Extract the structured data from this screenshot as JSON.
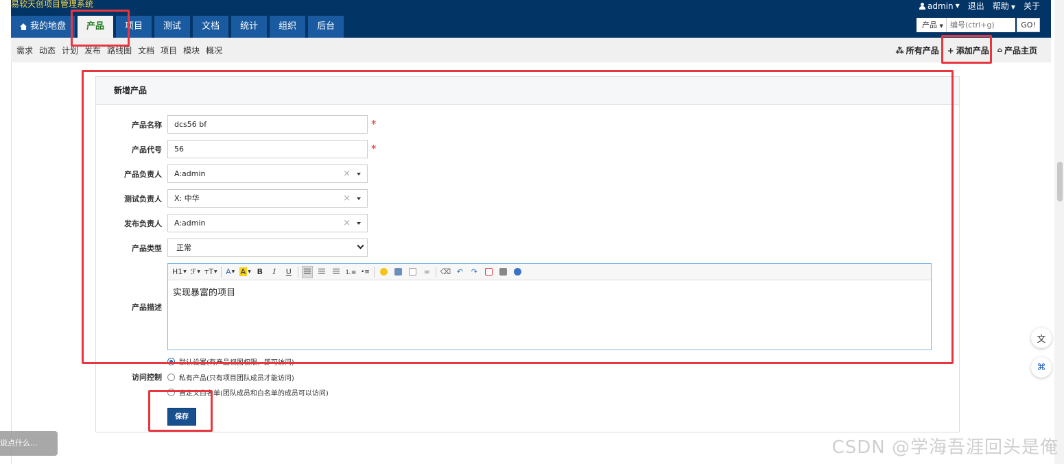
{
  "app": {
    "brand": "易软天创项目管理系统"
  },
  "topright": {
    "user": "admin",
    "logout": "退出",
    "help": "帮助",
    "about": "关于"
  },
  "mainnav": {
    "items": [
      "我的地盘",
      "产品",
      "项目",
      "测试",
      "文档",
      "统计",
      "组织",
      "后台"
    ],
    "active": "产品"
  },
  "search": {
    "type": "产品",
    "placeholder": "编号(ctrl+g)",
    "go": "GO!"
  },
  "subnav": {
    "left": [
      "需求",
      "动态",
      "计划",
      "发布",
      "路线图",
      "文档",
      "项目",
      "模块",
      "概况"
    ],
    "right": {
      "all": "所有产品",
      "add": "添加产品",
      "home": "产品主页"
    }
  },
  "form": {
    "title": "新增产品",
    "name": {
      "label": "产品名称",
      "value": "dcs56 bf"
    },
    "code": {
      "label": "产品代号",
      "value": "56"
    },
    "po": {
      "label": "产品负责人",
      "value": "A:admin"
    },
    "qd": {
      "label": "测试负责人",
      "value": "X: 中华"
    },
    "rd": {
      "label": "发布负责人",
      "value": "A:admin"
    },
    "type": {
      "label": "产品类型",
      "value": "正常"
    },
    "desc": {
      "label": "产品描述",
      "value": "实现暴富的项目"
    },
    "acl": {
      "label": "访问控制",
      "options": [
        "默认设置(有产品视图权限，即可访问)",
        "私有产品(只有项目团队成员才能访问)",
        "自定义白名单(团队成员和白名单的成员可以访问)"
      ],
      "selected": 0
    },
    "save": "保存"
  },
  "toolbar": {
    "h1": "H1",
    "font": "ℱ",
    "size": "тT",
    "bold": "B",
    "italic": "I",
    "underline": "U"
  },
  "chat": {
    "placeholder": "说点什么..."
  },
  "watermark": "CSDN @学海吾涯回头是俺",
  "colors": {
    "header": "#033466",
    "tab": "#1a5aa0",
    "brand": "#f0d34b",
    "annotation": "#e8363f",
    "primary": "#174f8f"
  }
}
